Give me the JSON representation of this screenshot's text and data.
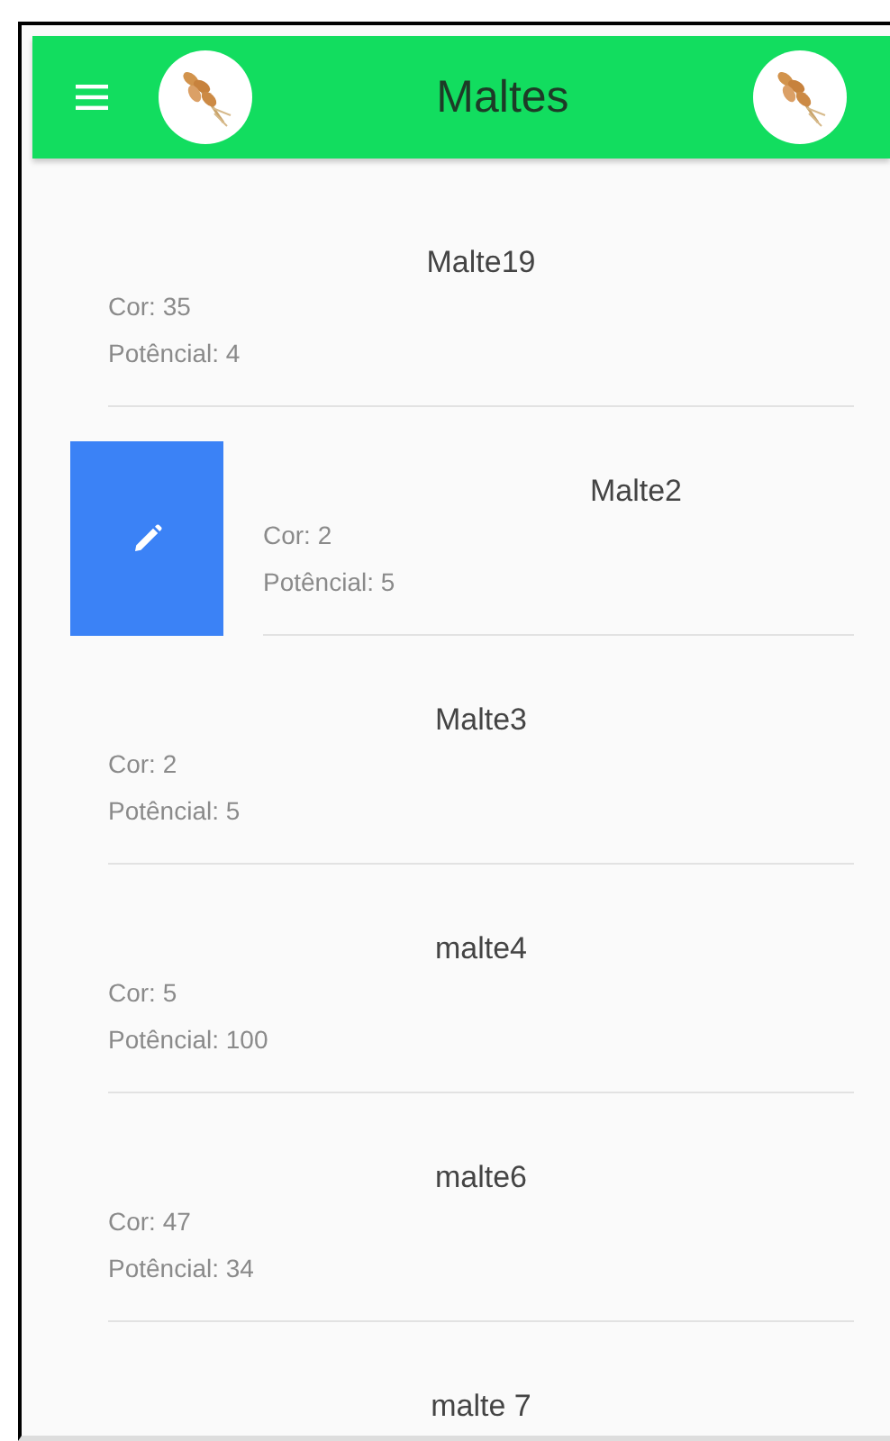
{
  "header": {
    "title": "Maltes"
  },
  "items": [
    {
      "name": "Malte19",
      "cor": "Cor: 35",
      "potencial": "Potêncial: 4",
      "swiped": false
    },
    {
      "name": "Malte2",
      "cor": "Cor: 2",
      "potencial": "Potêncial: 5",
      "swiped": true
    },
    {
      "name": "Malte3",
      "cor": "Cor: 2",
      "potencial": "Potêncial: 5",
      "swiped": false
    },
    {
      "name": "malte4",
      "cor": "Cor: 5",
      "potencial": "Potêncial: 100",
      "swiped": false
    },
    {
      "name": "malte6",
      "cor": "Cor: 47",
      "potencial": "Potêncial: 34",
      "swiped": false
    },
    {
      "name": "malte 7",
      "swiped": false
    }
  ]
}
